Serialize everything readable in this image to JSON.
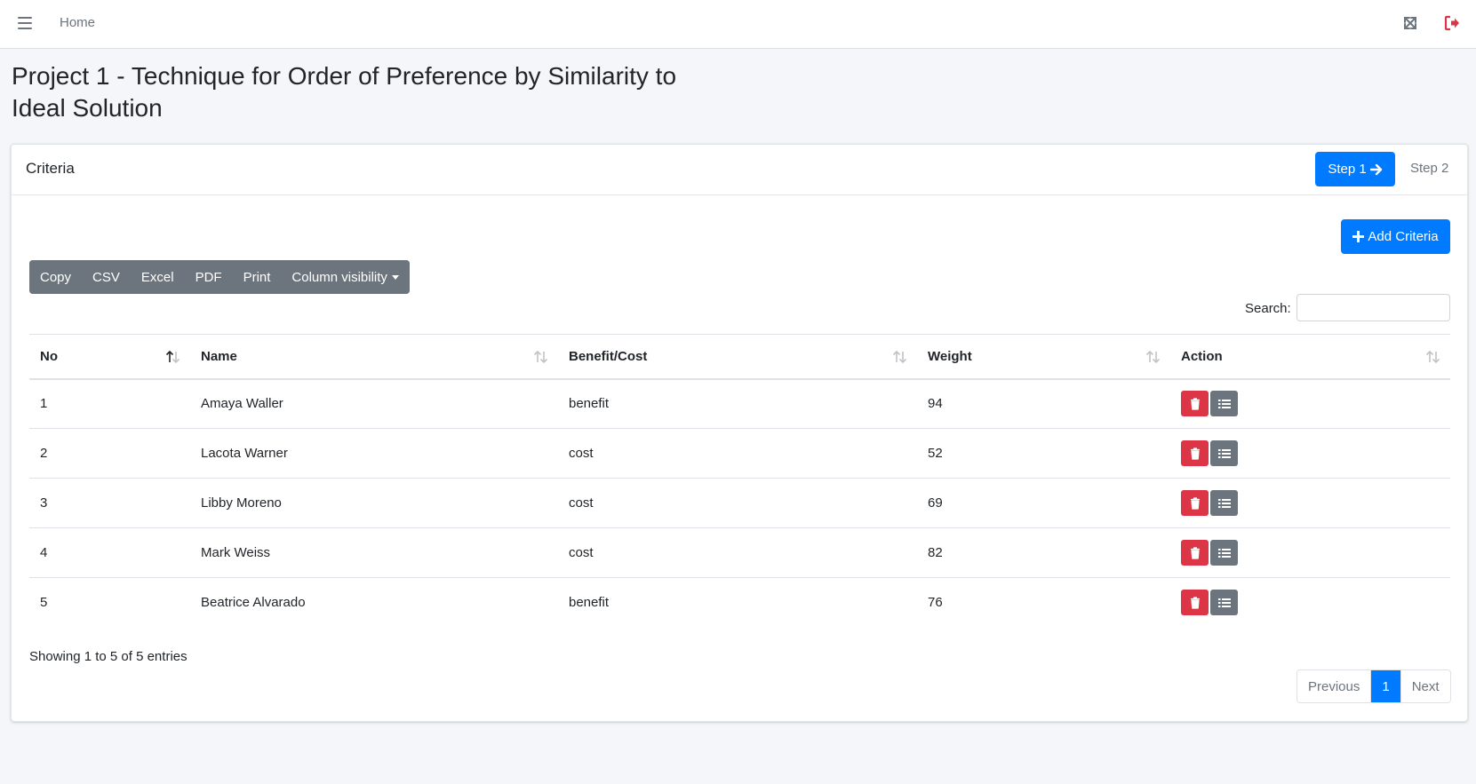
{
  "topbar": {
    "home_label": "Home"
  },
  "page": {
    "title": "Project 1 - Technique for Order of Preference by Similarity to Ideal Solution"
  },
  "card": {
    "title": "Criteria",
    "step1_label": "Step 1",
    "step2_label": "Step 2",
    "add_label": "Add Criteria"
  },
  "toolbar": {
    "buttons": [
      "Copy",
      "CSV",
      "Excel",
      "PDF",
      "Print",
      "Column visibility"
    ]
  },
  "search": {
    "label": "Search:",
    "value": ""
  },
  "table": {
    "headers": [
      "No",
      "Name",
      "Benefit/Cost",
      "Weight",
      "Action"
    ],
    "rows": [
      {
        "no": "1",
        "name": "Amaya Waller",
        "type": "benefit",
        "weight": "94"
      },
      {
        "no": "2",
        "name": "Lacota Warner",
        "type": "cost",
        "weight": "52"
      },
      {
        "no": "3",
        "name": "Libby Moreno",
        "type": "cost",
        "weight": "69"
      },
      {
        "no": "4",
        "name": "Mark Weiss",
        "type": "cost",
        "weight": "82"
      },
      {
        "no": "5",
        "name": "Beatrice Alvarado",
        "type": "benefit",
        "weight": "76"
      }
    ]
  },
  "footer": {
    "info": "Showing 1 to 5 of 5 entries",
    "prev": "Previous",
    "page": "1",
    "next": "Next"
  },
  "colors": {
    "primary": "#007bff",
    "danger": "#dc3545",
    "secondary": "#6c757d"
  }
}
